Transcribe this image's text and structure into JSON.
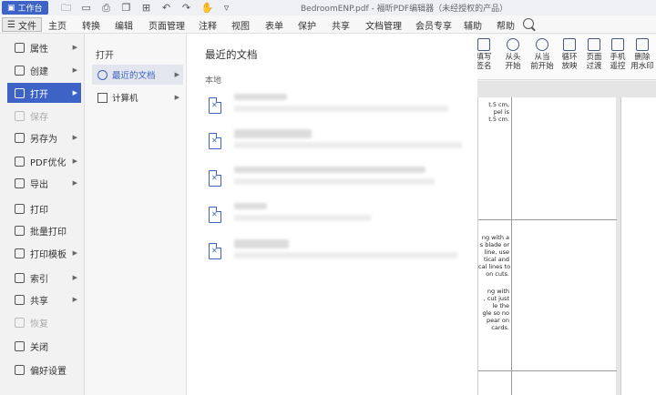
{
  "titlebar": {
    "workbench_label": "工作台",
    "window_title": "BedroomENP.pdf - 福昕PDF编辑器（未经授权的产品）"
  },
  "menubar": {
    "file_label": "文件",
    "items": [
      "主页",
      "转换",
      "编辑",
      "页面管理",
      "注释",
      "视图",
      "表单",
      "保护",
      "共享",
      "文档管理",
      "会员专享",
      "辅助",
      "帮助"
    ]
  },
  "ribbon": {
    "buttons": [
      {
        "label": "填写\n签名",
        "icon": "pen-icon"
      },
      {
        "label": "从头\n开始",
        "icon": "play-icon"
      },
      {
        "label": "从当\n前开始",
        "icon": "play-current-icon"
      },
      {
        "label": "循环\n放映",
        "icon": "loop-icon"
      },
      {
        "label": "页面\n过渡",
        "icon": "transition-icon"
      },
      {
        "label": "手机\n遥控",
        "icon": "phone-icon"
      },
      {
        "label": "删除\n用水印",
        "icon": "watermark-icon"
      }
    ]
  },
  "file_menu": {
    "items": [
      {
        "label": "属性",
        "icon": "properties-icon",
        "arrow": true,
        "state": "normal"
      },
      {
        "label": "创建",
        "icon": "create-icon",
        "arrow": true,
        "state": "normal"
      },
      {
        "label": "打开",
        "icon": "open-icon",
        "arrow": true,
        "state": "active"
      },
      {
        "label": "保存",
        "icon": "save-icon",
        "arrow": false,
        "state": "disabled"
      },
      {
        "label": "另存为",
        "icon": "save-as-icon",
        "arrow": true,
        "state": "normal"
      },
      {
        "label": "PDF优化",
        "icon": "optimize-icon",
        "arrow": true,
        "state": "normal"
      },
      {
        "label": "导出",
        "icon": "export-icon",
        "arrow": true,
        "state": "normal"
      },
      {
        "label": "打印",
        "icon": "print-icon",
        "arrow": false,
        "state": "normal"
      },
      {
        "label": "批量打印",
        "icon": "batch-print-icon",
        "arrow": false,
        "state": "normal"
      },
      {
        "label": "打印模板",
        "icon": "print-template-icon",
        "arrow": true,
        "state": "normal"
      },
      {
        "label": "索引",
        "icon": "index-icon",
        "arrow": true,
        "state": "normal"
      },
      {
        "label": "共享",
        "icon": "share-icon",
        "arrow": true,
        "state": "normal"
      },
      {
        "label": "恢复",
        "icon": "restore-icon",
        "arrow": false,
        "state": "disabled"
      },
      {
        "label": "关闭",
        "icon": "close-doc-icon",
        "arrow": false,
        "state": "normal"
      },
      {
        "label": "偏好设置",
        "icon": "preferences-icon",
        "arrow": false,
        "state": "normal"
      }
    ]
  },
  "open_submenu": {
    "heading": "打开",
    "items": [
      {
        "label": "最近的文档",
        "icon": "clock-icon",
        "selected": true
      },
      {
        "label": "计算机",
        "icon": "computer-icon",
        "selected": false
      }
    ]
  },
  "recent": {
    "title": "最近的文档",
    "section": "本地",
    "file_count": 5
  },
  "document_fragments": [
    "t.5 cm,\npel is\nt.5 cm.",
    "ng with a\ns blade or\nline, use\ntical and\ncal lines to\non cuts.",
    "ng with\n, cut just\nle the\ngle so no\npear on\ncards."
  ],
  "colors": {
    "accent": "#3c63c5",
    "overlay": "#777777"
  }
}
